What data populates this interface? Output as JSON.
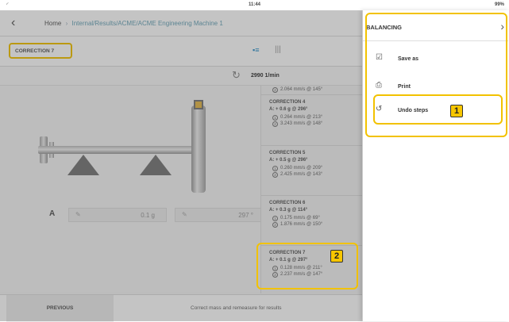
{
  "status_bar": {
    "time": "11:44",
    "battery": "99%"
  },
  "nav": {
    "back_icon": "chevron-left-icon",
    "breadcrumb_home": "Home",
    "breadcrumb_path": "Internal/Results/ACME/ACME Engineering Machine 1"
  },
  "toolbar": {
    "correction_label": "CORRECTION 7"
  },
  "speed": {
    "value": "2990 1/min"
  },
  "correction_input": {
    "plane_label": "A",
    "mass_value": "0.1 g",
    "angle_value": "297 °"
  },
  "history": {
    "top_partial": "2.064 mm/s @ 145°",
    "items": [
      {
        "title": "CORRECTION 4",
        "action": "A: + 0.6 g @ 296°",
        "m1": "0.264 mm/s @ 213°",
        "m2": "3.243 mm/s @ 148°"
      },
      {
        "title": "CORRECTION 5",
        "action": "A: + 0.5 g @ 296°",
        "m1": "0.260 mm/s @ 209°",
        "m2": "2.425 mm/s @ 143°"
      },
      {
        "title": "CORRECTION 6",
        "action": "A: + 0.3 g @ 114°",
        "m1": "0.175 mm/s @ 69°",
        "m2": "1.876 mm/s @ 150°"
      },
      {
        "title": "CORRECTION 7",
        "action": "A: + 0.1 g @ 297°",
        "m1": "0.128 mm/s @ 211°",
        "m2": "2.237 mm/s @ 147°"
      }
    ]
  },
  "bottom": {
    "previous_label": "PREVIOUS",
    "status_message": "Correct mass and remeasure for results"
  },
  "menu": {
    "title": "BALANCING",
    "items": [
      {
        "label": "Save as",
        "icon": "save-icon"
      },
      {
        "label": "Print",
        "icon": "print-icon"
      },
      {
        "label": "Undo steps",
        "icon": "undo-icon"
      }
    ]
  },
  "callouts": {
    "one": "1",
    "two": "2"
  },
  "colors": {
    "highlight": "#f2c200",
    "accent": "#2b8fc9",
    "badge": "#f7c600"
  }
}
